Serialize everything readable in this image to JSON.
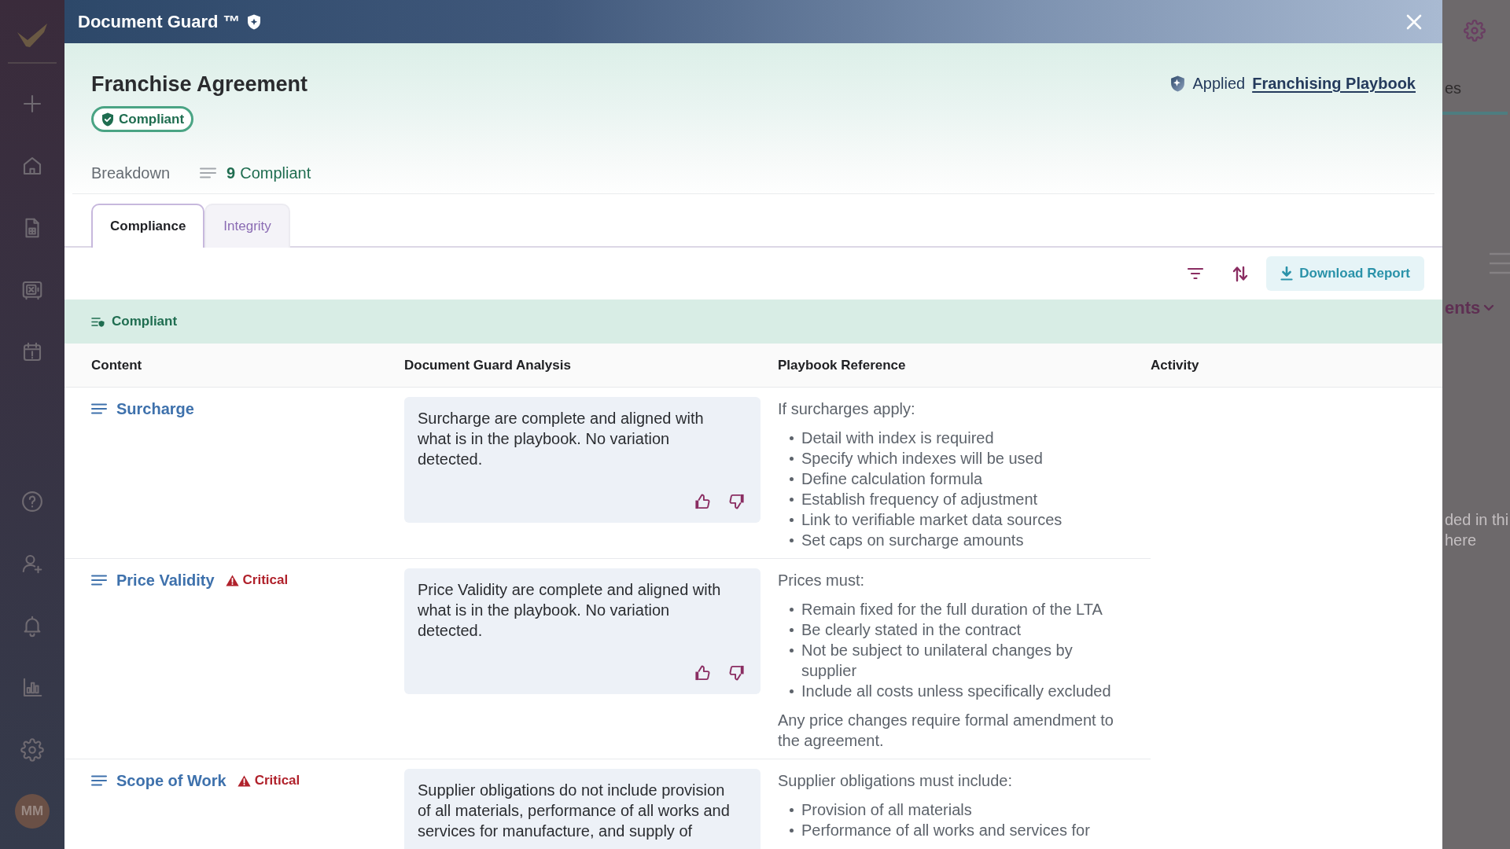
{
  "sidebar": {
    "avatar": "MM"
  },
  "dialog": {
    "title": "Document Guard ™"
  },
  "document": {
    "title": "Franchise Agreement",
    "status": "Compliant",
    "playbook_prefix": "Applied",
    "playbook_link": "Franchising Playbook"
  },
  "breakdown": {
    "label": "Breakdown",
    "count": "9",
    "count_label": "Compliant"
  },
  "tabs": [
    {
      "label": "Compliance",
      "selected": true
    },
    {
      "label": "Integrity",
      "selected": false
    }
  ],
  "toolbar": {
    "download_button": "Download Report"
  },
  "group": {
    "label": "Compliant"
  },
  "table": {
    "columns": [
      "Content",
      "Document Guard Analysis",
      "Playbook Reference",
      "Activity"
    ],
    "rows": [
      {
        "clause": "Surcharge",
        "analysis": "Surcharge are complete and aligned with what is in the playbook. No variation detected.",
        "reference": [
          {
            "kind": "text",
            "text": "If surcharges apply:"
          },
          {
            "kind": "list",
            "items": [
              "Detail with index is required",
              "Specify which indexes will be used",
              "Define calculation formula",
              "Establish frequency of adjustment",
              "Link to verifiable market data sources",
              "Set caps on surcharge amounts"
            ]
          }
        ]
      },
      {
        "clause": "Price Validity",
        "flag": "Critical",
        "analysis": "Price Validity are complete and aligned with what is in the playbook. No variation detected.",
        "reference": [
          {
            "kind": "text",
            "text": "Prices must:"
          },
          {
            "kind": "list",
            "items": [
              "Remain fixed for the full duration of the LTA",
              "Be clearly stated in the contract",
              "Not be subject to unilateral changes by supplier",
              "Include all costs unless specifically excluded"
            ]
          },
          {
            "kind": "text",
            "text": "Any price changes require formal amendment to the agreement."
          }
        ]
      },
      {
        "clause": "Scope of Work",
        "flag": "Critical",
        "analysis": "Supplier obligations do not include provision of all materials, performance of all works and services for manufacture, and supply of",
        "reference": [
          {
            "kind": "text",
            "text": "Supplier obligations must include:"
          },
          {
            "kind": "list",
            "items": [
              "Provision of all materials",
              "Performance of all works and services for"
            ]
          }
        ]
      }
    ]
  },
  "background": {
    "tab_fragment": "es",
    "menu_fragment": "ents",
    "note_lines": [
      "ded in thi",
      "here"
    ]
  }
}
